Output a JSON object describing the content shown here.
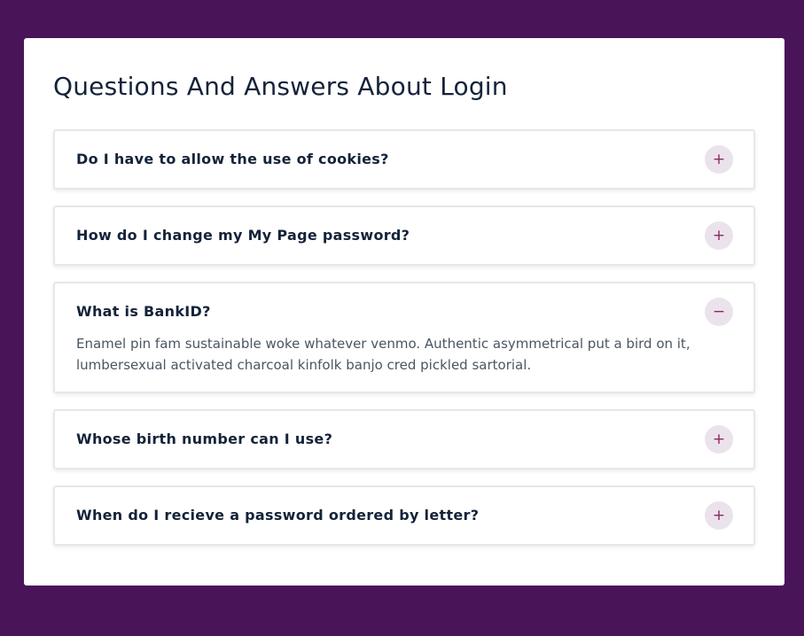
{
  "page": {
    "title": "Questions And Answers About Login"
  },
  "colors": {
    "background": "#4a1459",
    "card": "#ffffff",
    "text_dark": "#14233a",
    "text_body": "#4b5563",
    "toggle_bg": "#ebe3ec",
    "toggle_icon": "#8c2960"
  },
  "faq": [
    {
      "question": "Do I have to allow the use of cookies?",
      "expanded": false,
      "toggle_icon": "plus-icon",
      "toggle_symbol": "+"
    },
    {
      "question": "How do I change my My Page password?",
      "expanded": false,
      "toggle_icon": "plus-icon",
      "toggle_symbol": "+"
    },
    {
      "question": "What is BankID?",
      "expanded": true,
      "toggle_icon": "minus-icon",
      "toggle_symbol": "−",
      "answer": "Enamel pin fam sustainable woke whatever venmo. Authentic asymmetrical put a bird on it, lumbersexual activated charcoal kinfolk banjo cred pickled sartorial."
    },
    {
      "question": "Whose birth number can I use?",
      "expanded": false,
      "toggle_icon": "plus-icon",
      "toggle_symbol": "+"
    },
    {
      "question": "When do I recieve a password ordered by letter?",
      "expanded": false,
      "toggle_icon": "plus-icon",
      "toggle_symbol": "+"
    }
  ]
}
